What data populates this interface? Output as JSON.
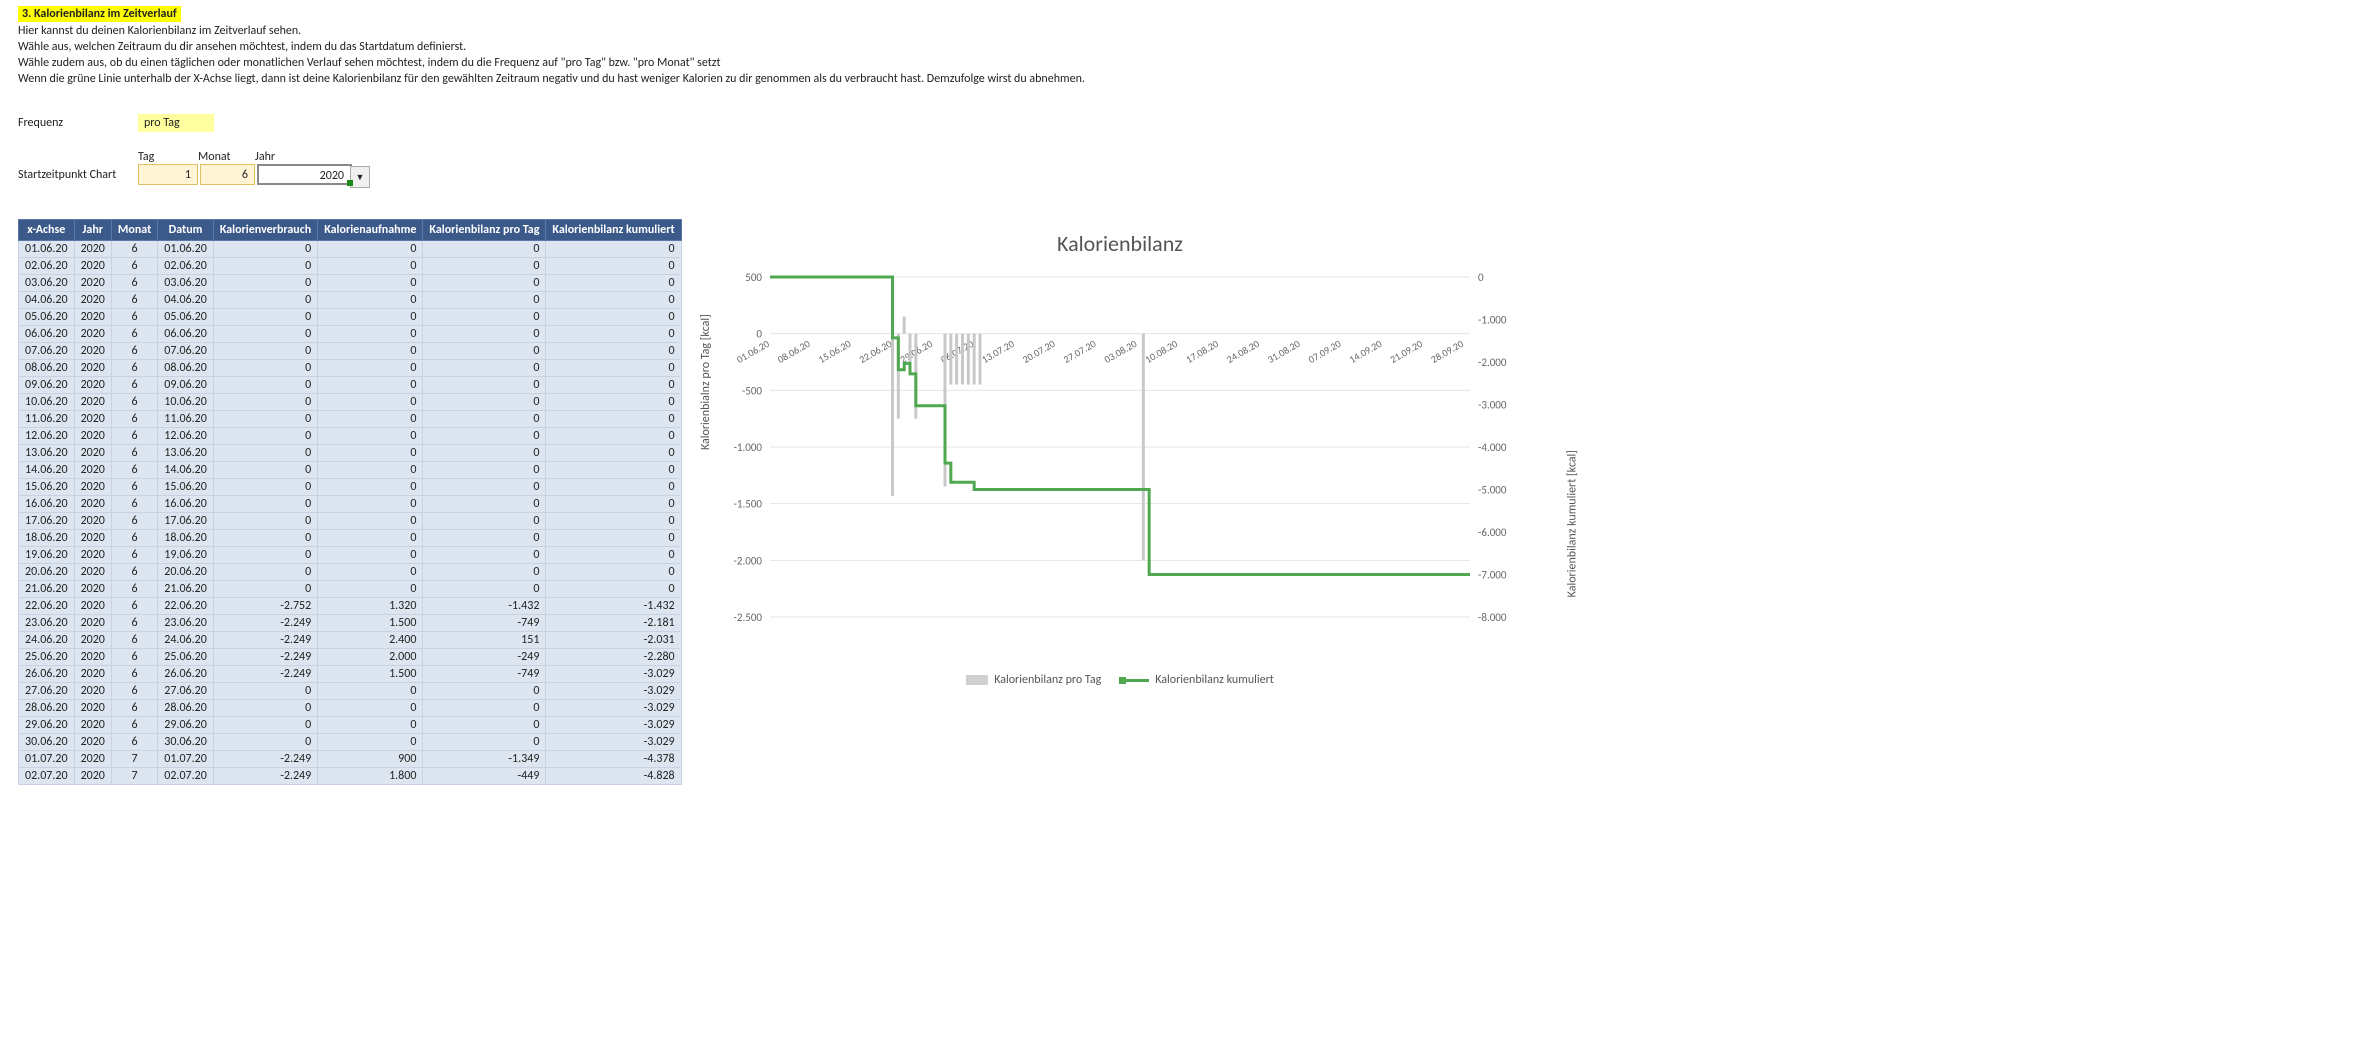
{
  "header": {
    "title": "3. Kalorienbilanz im Zeitverlauf",
    "lines": [
      "Hier kannst du deinen Kalorienbilanz im Zeitverlauf sehen.",
      "Wähle aus, welchen Zeitraum du dir ansehen möchtest, indem du das Startdatum definierst.",
      "Wähle zudem aus, ob du einen täglichen oder monatlichen Verlauf sehen möchtest, indem du die Frequenz auf \"pro Tag\" bzw. \"pro Monat\" setzt",
      "Wenn die grüne Linie unterhalb der X-Achse liegt, dann ist deine Kalorienbilanz für den gewählten Zeitraum negativ und du hast weniger Kalorien zu dir genommen als du verbraucht hast. Demzufolge wirst du abnehmen."
    ]
  },
  "params": {
    "frequenz_label": "Frequenz",
    "frequenz_value": "pro Tag",
    "headers": {
      "tag": "Tag",
      "monat": "Monat",
      "jahr": "Jahr"
    },
    "start_label": "Startzeitpunkt Chart",
    "tag": "1",
    "monat": "6",
    "jahr": "2020"
  },
  "table": {
    "headers": [
      "x-Achse",
      "Jahr",
      "Monat",
      "Datum",
      "Kalorienverbrauch",
      "Kalorienaufnahme",
      "Kalorienbilanz pro Tag",
      "Kalorienbilanz kumuliert"
    ],
    "rows": [
      [
        "01.06.20",
        "2020",
        "6",
        "01.06.20",
        "0",
        "0",
        "0",
        "0"
      ],
      [
        "02.06.20",
        "2020",
        "6",
        "02.06.20",
        "0",
        "0",
        "0",
        "0"
      ],
      [
        "03.06.20",
        "2020",
        "6",
        "03.06.20",
        "0",
        "0",
        "0",
        "0"
      ],
      [
        "04.06.20",
        "2020",
        "6",
        "04.06.20",
        "0",
        "0",
        "0",
        "0"
      ],
      [
        "05.06.20",
        "2020",
        "6",
        "05.06.20",
        "0",
        "0",
        "0",
        "0"
      ],
      [
        "06.06.20",
        "2020",
        "6",
        "06.06.20",
        "0",
        "0",
        "0",
        "0"
      ],
      [
        "07.06.20",
        "2020",
        "6",
        "07.06.20",
        "0",
        "0",
        "0",
        "0"
      ],
      [
        "08.06.20",
        "2020",
        "6",
        "08.06.20",
        "0",
        "0",
        "0",
        "0"
      ],
      [
        "09.06.20",
        "2020",
        "6",
        "09.06.20",
        "0",
        "0",
        "0",
        "0"
      ],
      [
        "10.06.20",
        "2020",
        "6",
        "10.06.20",
        "0",
        "0",
        "0",
        "0"
      ],
      [
        "11.06.20",
        "2020",
        "6",
        "11.06.20",
        "0",
        "0",
        "0",
        "0"
      ],
      [
        "12.06.20",
        "2020",
        "6",
        "12.06.20",
        "0",
        "0",
        "0",
        "0"
      ],
      [
        "13.06.20",
        "2020",
        "6",
        "13.06.20",
        "0",
        "0",
        "0",
        "0"
      ],
      [
        "14.06.20",
        "2020",
        "6",
        "14.06.20",
        "0",
        "0",
        "0",
        "0"
      ],
      [
        "15.06.20",
        "2020",
        "6",
        "15.06.20",
        "0",
        "0",
        "0",
        "0"
      ],
      [
        "16.06.20",
        "2020",
        "6",
        "16.06.20",
        "0",
        "0",
        "0",
        "0"
      ],
      [
        "17.06.20",
        "2020",
        "6",
        "17.06.20",
        "0",
        "0",
        "0",
        "0"
      ],
      [
        "18.06.20",
        "2020",
        "6",
        "18.06.20",
        "0",
        "0",
        "0",
        "0"
      ],
      [
        "19.06.20",
        "2020",
        "6",
        "19.06.20",
        "0",
        "0",
        "0",
        "0"
      ],
      [
        "20.06.20",
        "2020",
        "6",
        "20.06.20",
        "0",
        "0",
        "0",
        "0"
      ],
      [
        "21.06.20",
        "2020",
        "6",
        "21.06.20",
        "0",
        "0",
        "0",
        "0"
      ],
      [
        "22.06.20",
        "2020",
        "6",
        "22.06.20",
        "-2.752",
        "1.320",
        "-1.432",
        "-1.432"
      ],
      [
        "23.06.20",
        "2020",
        "6",
        "23.06.20",
        "-2.249",
        "1.500",
        "-749",
        "-2.181"
      ],
      [
        "24.06.20",
        "2020",
        "6",
        "24.06.20",
        "-2.249",
        "2.400",
        "151",
        "-2.031"
      ],
      [
        "25.06.20",
        "2020",
        "6",
        "25.06.20",
        "-2.249",
        "2.000",
        "-249",
        "-2.280"
      ],
      [
        "26.06.20",
        "2020",
        "6",
        "26.06.20",
        "-2.249",
        "1.500",
        "-749",
        "-3.029"
      ],
      [
        "27.06.20",
        "2020",
        "6",
        "27.06.20",
        "0",
        "0",
        "0",
        "-3.029"
      ],
      [
        "28.06.20",
        "2020",
        "6",
        "28.06.20",
        "0",
        "0",
        "0",
        "-3.029"
      ],
      [
        "29.06.20",
        "2020",
        "6",
        "29.06.20",
        "0",
        "0",
        "0",
        "-3.029"
      ],
      [
        "30.06.20",
        "2020",
        "6",
        "30.06.20",
        "0",
        "0",
        "0",
        "-3.029"
      ],
      [
        "01.07.20",
        "2020",
        "7",
        "01.07.20",
        "-2.249",
        "900",
        "-1.349",
        "-4.378"
      ],
      [
        "02.07.20",
        "2020",
        "7",
        "02.07.20",
        "-2.249",
        "1.800",
        "-449",
        "-4.828"
      ]
    ]
  },
  "chart_data": {
    "type": "bar+line",
    "title": "Kalorienbilanz",
    "y_left_label": "Kalorienbialnz pro Tag [kcal]",
    "y_right_label": "Kalorienbilanz kumuliert [kcal]",
    "y_left_ticks": [
      500,
      0,
      -500,
      -1000,
      -1500,
      -2000,
      -2500
    ],
    "y_right_ticks": [
      0,
      -1000,
      -2000,
      -3000,
      -4000,
      -5000,
      -6000,
      -7000,
      -8000
    ],
    "x_tick_labels": [
      "01.06.20",
      "08.06.20",
      "15.06.20",
      "22.06.20",
      "29.06.20",
      "06.07.20",
      "13.07.20",
      "20.07.20",
      "27.07.20",
      "03.08.20",
      "10.08.20",
      "17.08.20",
      "24.08.20",
      "31.08.20",
      "07.09.20",
      "14.09.20",
      "21.09.20",
      "28.09.20"
    ],
    "legend": [
      "Kalorienbilanz pro Tag",
      "Kalorienbilanz kumuliert"
    ],
    "series": [
      {
        "name": "Kalorienbilanz pro Tag",
        "kind": "bar",
        "x": [
          "01.06.20",
          "02.06.20",
          "03.06.20",
          "04.06.20",
          "05.06.20",
          "06.06.20",
          "07.06.20",
          "08.06.20",
          "09.06.20",
          "10.06.20",
          "11.06.20",
          "12.06.20",
          "13.06.20",
          "14.06.20",
          "15.06.20",
          "16.06.20",
          "17.06.20",
          "18.06.20",
          "19.06.20",
          "20.06.20",
          "21.06.20",
          "22.06.20",
          "23.06.20",
          "24.06.20",
          "25.06.20",
          "26.06.20",
          "27.06.20",
          "28.06.20",
          "29.06.20",
          "30.06.20",
          "01.07.20",
          "02.07.20",
          "03.07.20",
          "04.07.20",
          "05.07.20",
          "06.07.20",
          "07.07.20",
          "08.07.20",
          "09.07.20",
          "10.07.20",
          "11.07.20",
          "12.07.20",
          "13.07.20",
          "14.07.20",
          "15.07.20",
          "16.07.20",
          "17.07.20",
          "18.07.20",
          "19.07.20",
          "20.07.20",
          "21.07.20",
          "22.07.20",
          "23.07.20",
          "24.07.20",
          "25.07.20",
          "26.07.20",
          "27.07.20",
          "28.07.20",
          "29.07.20",
          "30.07.20",
          "31.07.20",
          "01.08.20",
          "02.08.20",
          "03.08.20",
          "04.08.20",
          "05.08.20"
        ],
        "values": [
          0,
          0,
          0,
          0,
          0,
          0,
          0,
          0,
          0,
          0,
          0,
          0,
          0,
          0,
          0,
          0,
          0,
          0,
          0,
          0,
          0,
          -1432,
          -749,
          151,
          -249,
          -749,
          0,
          0,
          0,
          0,
          -1349,
          -449,
          -449,
          -449,
          -449,
          -449,
          -449,
          0,
          0,
          0,
          0,
          0,
          0,
          0,
          0,
          0,
          0,
          0,
          0,
          0,
          0,
          0,
          0,
          0,
          0,
          0,
          0,
          0,
          0,
          0,
          0,
          0,
          0,
          0,
          -2000,
          0
        ]
      },
      {
        "name": "Kalorienbilanz kumuliert",
        "kind": "line",
        "x": [
          "01.06.20",
          "21.06.20",
          "22.06.20",
          "23.06.20",
          "24.06.20",
          "25.06.20",
          "26.06.20",
          "30.06.20",
          "01.07.20",
          "02.07.20",
          "06.07.20",
          "04.08.20",
          "05.08.20",
          "30.09.20"
        ],
        "values": [
          0,
          0,
          -1432,
          -2181,
          -2031,
          -2280,
          -3029,
          -3029,
          -4378,
          -4828,
          -5000,
          -5000,
          -7000,
          -7000
        ]
      }
    ]
  }
}
